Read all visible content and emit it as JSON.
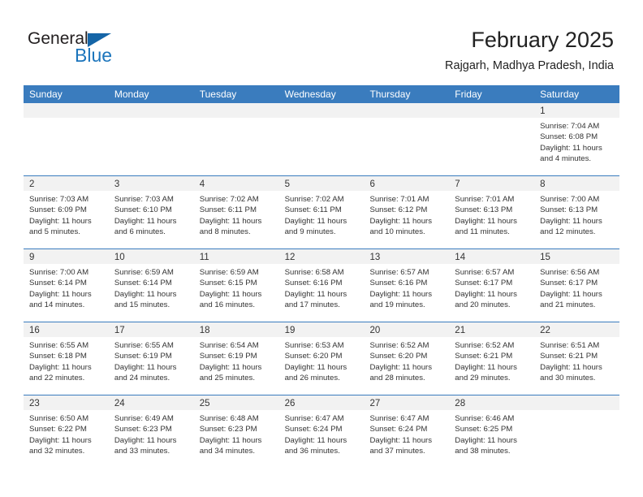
{
  "brand": {
    "name_part1": "General",
    "name_part2": "Blue",
    "triangle_icon": "triangle-icon",
    "accent_color": "#1c75bc",
    "header_color": "#3a7cbe"
  },
  "header": {
    "month_title": "February 2025",
    "location": "Rajgarh, Madhya Pradesh, India"
  },
  "calendar": {
    "weekdays": [
      "Sunday",
      "Monday",
      "Tuesday",
      "Wednesday",
      "Thursday",
      "Friday",
      "Saturday"
    ],
    "labels": {
      "sunrise": "Sunrise:",
      "sunset": "Sunset:",
      "daylight": "Daylight:"
    },
    "weeks": [
      [
        {
          "day": "",
          "empty": true
        },
        {
          "day": "",
          "empty": true
        },
        {
          "day": "",
          "empty": true
        },
        {
          "day": "",
          "empty": true
        },
        {
          "day": "",
          "empty": true
        },
        {
          "day": "",
          "empty": true
        },
        {
          "day": "1",
          "sunrise": "Sunrise: 7:04 AM",
          "sunset": "Sunset: 6:08 PM",
          "daylight1": "Daylight: 11 hours",
          "daylight2": "and 4 minutes."
        }
      ],
      [
        {
          "day": "2",
          "sunrise": "Sunrise: 7:03 AM",
          "sunset": "Sunset: 6:09 PM",
          "daylight1": "Daylight: 11 hours",
          "daylight2": "and 5 minutes."
        },
        {
          "day": "3",
          "sunrise": "Sunrise: 7:03 AM",
          "sunset": "Sunset: 6:10 PM",
          "daylight1": "Daylight: 11 hours",
          "daylight2": "and 6 minutes."
        },
        {
          "day": "4",
          "sunrise": "Sunrise: 7:02 AM",
          "sunset": "Sunset: 6:11 PM",
          "daylight1": "Daylight: 11 hours",
          "daylight2": "and 8 minutes."
        },
        {
          "day": "5",
          "sunrise": "Sunrise: 7:02 AM",
          "sunset": "Sunset: 6:11 PM",
          "daylight1": "Daylight: 11 hours",
          "daylight2": "and 9 minutes."
        },
        {
          "day": "6",
          "sunrise": "Sunrise: 7:01 AM",
          "sunset": "Sunset: 6:12 PM",
          "daylight1": "Daylight: 11 hours",
          "daylight2": "and 10 minutes."
        },
        {
          "day": "7",
          "sunrise": "Sunrise: 7:01 AM",
          "sunset": "Sunset: 6:13 PM",
          "daylight1": "Daylight: 11 hours",
          "daylight2": "and 11 minutes."
        },
        {
          "day": "8",
          "sunrise": "Sunrise: 7:00 AM",
          "sunset": "Sunset: 6:13 PM",
          "daylight1": "Daylight: 11 hours",
          "daylight2": "and 12 minutes."
        }
      ],
      [
        {
          "day": "9",
          "sunrise": "Sunrise: 7:00 AM",
          "sunset": "Sunset: 6:14 PM",
          "daylight1": "Daylight: 11 hours",
          "daylight2": "and 14 minutes."
        },
        {
          "day": "10",
          "sunrise": "Sunrise: 6:59 AM",
          "sunset": "Sunset: 6:14 PM",
          "daylight1": "Daylight: 11 hours",
          "daylight2": "and 15 minutes."
        },
        {
          "day": "11",
          "sunrise": "Sunrise: 6:59 AM",
          "sunset": "Sunset: 6:15 PM",
          "daylight1": "Daylight: 11 hours",
          "daylight2": "and 16 minutes."
        },
        {
          "day": "12",
          "sunrise": "Sunrise: 6:58 AM",
          "sunset": "Sunset: 6:16 PM",
          "daylight1": "Daylight: 11 hours",
          "daylight2": "and 17 minutes."
        },
        {
          "day": "13",
          "sunrise": "Sunrise: 6:57 AM",
          "sunset": "Sunset: 6:16 PM",
          "daylight1": "Daylight: 11 hours",
          "daylight2": "and 19 minutes."
        },
        {
          "day": "14",
          "sunrise": "Sunrise: 6:57 AM",
          "sunset": "Sunset: 6:17 PM",
          "daylight1": "Daylight: 11 hours",
          "daylight2": "and 20 minutes."
        },
        {
          "day": "15",
          "sunrise": "Sunrise: 6:56 AM",
          "sunset": "Sunset: 6:17 PM",
          "daylight1": "Daylight: 11 hours",
          "daylight2": "and 21 minutes."
        }
      ],
      [
        {
          "day": "16",
          "sunrise": "Sunrise: 6:55 AM",
          "sunset": "Sunset: 6:18 PM",
          "daylight1": "Daylight: 11 hours",
          "daylight2": "and 22 minutes."
        },
        {
          "day": "17",
          "sunrise": "Sunrise: 6:55 AM",
          "sunset": "Sunset: 6:19 PM",
          "daylight1": "Daylight: 11 hours",
          "daylight2": "and 24 minutes."
        },
        {
          "day": "18",
          "sunrise": "Sunrise: 6:54 AM",
          "sunset": "Sunset: 6:19 PM",
          "daylight1": "Daylight: 11 hours",
          "daylight2": "and 25 minutes."
        },
        {
          "day": "19",
          "sunrise": "Sunrise: 6:53 AM",
          "sunset": "Sunset: 6:20 PM",
          "daylight1": "Daylight: 11 hours",
          "daylight2": "and 26 minutes."
        },
        {
          "day": "20",
          "sunrise": "Sunrise: 6:52 AM",
          "sunset": "Sunset: 6:20 PM",
          "daylight1": "Daylight: 11 hours",
          "daylight2": "and 28 minutes."
        },
        {
          "day": "21",
          "sunrise": "Sunrise: 6:52 AM",
          "sunset": "Sunset: 6:21 PM",
          "daylight1": "Daylight: 11 hours",
          "daylight2": "and 29 minutes."
        },
        {
          "day": "22",
          "sunrise": "Sunrise: 6:51 AM",
          "sunset": "Sunset: 6:21 PM",
          "daylight1": "Daylight: 11 hours",
          "daylight2": "and 30 minutes."
        }
      ],
      [
        {
          "day": "23",
          "sunrise": "Sunrise: 6:50 AM",
          "sunset": "Sunset: 6:22 PM",
          "daylight1": "Daylight: 11 hours",
          "daylight2": "and 32 minutes."
        },
        {
          "day": "24",
          "sunrise": "Sunrise: 6:49 AM",
          "sunset": "Sunset: 6:23 PM",
          "daylight1": "Daylight: 11 hours",
          "daylight2": "and 33 minutes."
        },
        {
          "day": "25",
          "sunrise": "Sunrise: 6:48 AM",
          "sunset": "Sunset: 6:23 PM",
          "daylight1": "Daylight: 11 hours",
          "daylight2": "and 34 minutes."
        },
        {
          "day": "26",
          "sunrise": "Sunrise: 6:47 AM",
          "sunset": "Sunset: 6:24 PM",
          "daylight1": "Daylight: 11 hours",
          "daylight2": "and 36 minutes."
        },
        {
          "day": "27",
          "sunrise": "Sunrise: 6:47 AM",
          "sunset": "Sunset: 6:24 PM",
          "daylight1": "Daylight: 11 hours",
          "daylight2": "and 37 minutes."
        },
        {
          "day": "28",
          "sunrise": "Sunrise: 6:46 AM",
          "sunset": "Sunset: 6:25 PM",
          "daylight1": "Daylight: 11 hours",
          "daylight2": "and 38 minutes."
        },
        {
          "day": "",
          "empty": true
        }
      ]
    ]
  }
}
